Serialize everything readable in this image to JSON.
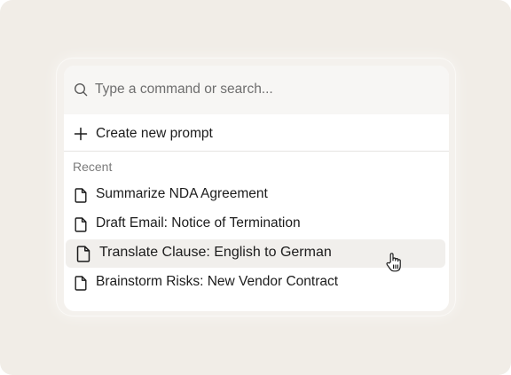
{
  "search": {
    "placeholder": "Type a command or search...",
    "value": ""
  },
  "create": {
    "label": "Create new prompt",
    "icon": "plus-icon"
  },
  "recent": {
    "heading": "Recent",
    "items": [
      {
        "label": "Summarize NDA Agreement",
        "icon": "document-icon"
      },
      {
        "label": "Draft Email: Notice of Termination",
        "icon": "document-icon"
      },
      {
        "label": "Translate Clause: English to German",
        "icon": "document-icon",
        "hovered": true
      },
      {
        "label": "Brainstorm Risks: New Vendor Contract",
        "icon": "document-icon"
      }
    ]
  },
  "colors": {
    "background": "#f1ede7",
    "panel": "#ffffff",
    "search_bar": "#f7f6f4",
    "hover_row": "#f1efec",
    "text": "#1c1c1c",
    "muted_text": "#7b7b7b"
  }
}
